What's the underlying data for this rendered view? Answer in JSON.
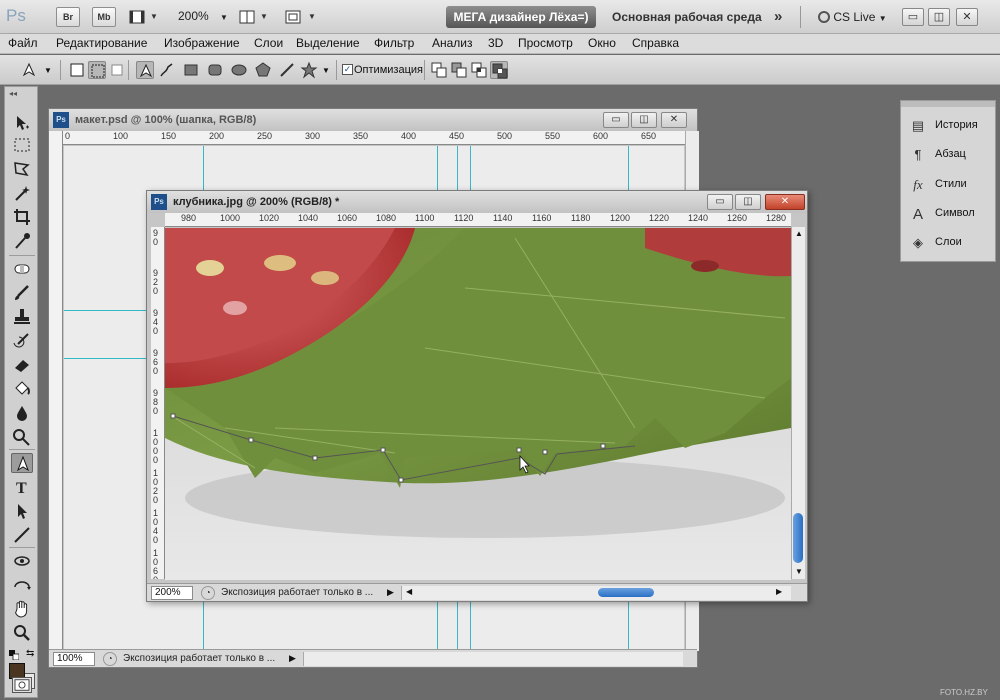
{
  "app": {
    "logo": "Ps",
    "bridge_button": "Br",
    "minibridge_button": "Mb",
    "zoom": "200%",
    "workspace_user": "МЕГА дизайнер Лёха=)",
    "workspace_name": "Основная рабочая среда",
    "cs_live": "CS Live",
    "win_minimize": "▭",
    "win_restore": "◫",
    "win_close": "✕"
  },
  "menu": [
    "Файл",
    "Редактирование",
    "Изображение",
    "Слои",
    "Выделение",
    "Фильтр",
    "Анализ",
    "3D",
    "Просмотр",
    "Окно",
    "Справка"
  ],
  "options_bar": {
    "auto_optimize_label": "Оптимизация",
    "auto_optimize_checked": true
  },
  "panels": {
    "items": [
      {
        "icon": "history-icon",
        "label": "История"
      },
      {
        "icon": "paragraph-icon",
        "label": "Абзац"
      },
      {
        "icon": "fx-styles-icon",
        "label": "Стили"
      },
      {
        "icon": "character-icon",
        "label": "Символ"
      },
      {
        "icon": "layers-icon",
        "label": "Слои"
      }
    ]
  },
  "doc_back": {
    "title": "макет.psd @ 100% (шапка, RGB/8)",
    "zoom": "100%",
    "status": "Экспозиция работает только в ...",
    "ruler_labels": [
      "0",
      "100",
      "150",
      "200",
      "250",
      "300",
      "350",
      "400",
      "450",
      "500",
      "550",
      "600",
      "650"
    ]
  },
  "doc_front": {
    "title": "клубника.jpg @ 200% (RGB/8) *",
    "zoom": "200%",
    "status": "Экспозиция работает только в ...",
    "ruler_labels": [
      "980",
      "1000",
      "1020",
      "1040",
      "1060",
      "1080",
      "1100",
      "1120",
      "1140",
      "1160",
      "1180",
      "1200",
      "1220",
      "1240",
      "1260",
      "1280"
    ],
    "vruler_labels": [
      "9\n0",
      "9\n2\n0",
      "9\n4\n0",
      "9\n6\n0",
      "9\n8\n0",
      "1\n0\n0\n0",
      "1\n0\n2\n0",
      "1\n0\n4\n0",
      "1\n0\n6\n0"
    ]
  },
  "colors": {
    "foreground": "#4a3620",
    "background": "#e8e8e8",
    "guide": "#35b7c6"
  },
  "watermark": "FOTO.HZ.BY"
}
